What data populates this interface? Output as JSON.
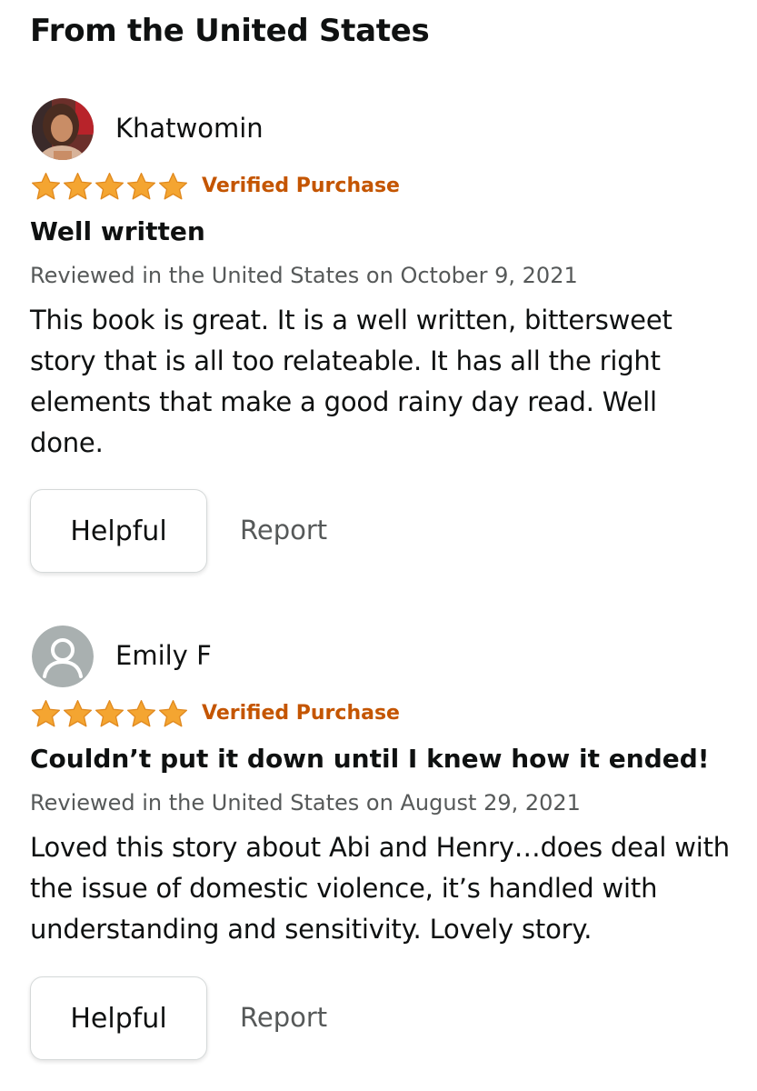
{
  "section": {
    "heading": "From the United States"
  },
  "colors": {
    "star": "#f4a531",
    "star_outline": "#e0891f",
    "verified": "#c45500",
    "muted_text": "#565959"
  },
  "reviews": [
    {
      "profile_name": "Khatwomin",
      "avatar": "user-photo",
      "rating": 5,
      "rating_max": 5,
      "verified_label": "Verified Purchase",
      "title": "Well written",
      "date_line": "Reviewed in the United States on October 9, 2021",
      "body": "This book is great. It is a well written, bittersweet story that is all too relateable. It has all the right elements that make a good rainy day read. Well done.",
      "helpful_label": "Helpful",
      "report_label": "Report"
    },
    {
      "profile_name": "Emily F",
      "avatar": "default-person-icon",
      "rating": 5,
      "rating_max": 5,
      "verified_label": "Verified Purchase",
      "title": "Couldn’t put it down until I knew how it ended!",
      "date_line": "Reviewed in the United States on August 29, 2021",
      "body": "Loved this story about Abi and Henry…does deal with the issue of domestic violence, it’s handled with understanding and sensitivity. Lovely story.",
      "helpful_label": "Helpful",
      "report_label": "Report"
    }
  ]
}
